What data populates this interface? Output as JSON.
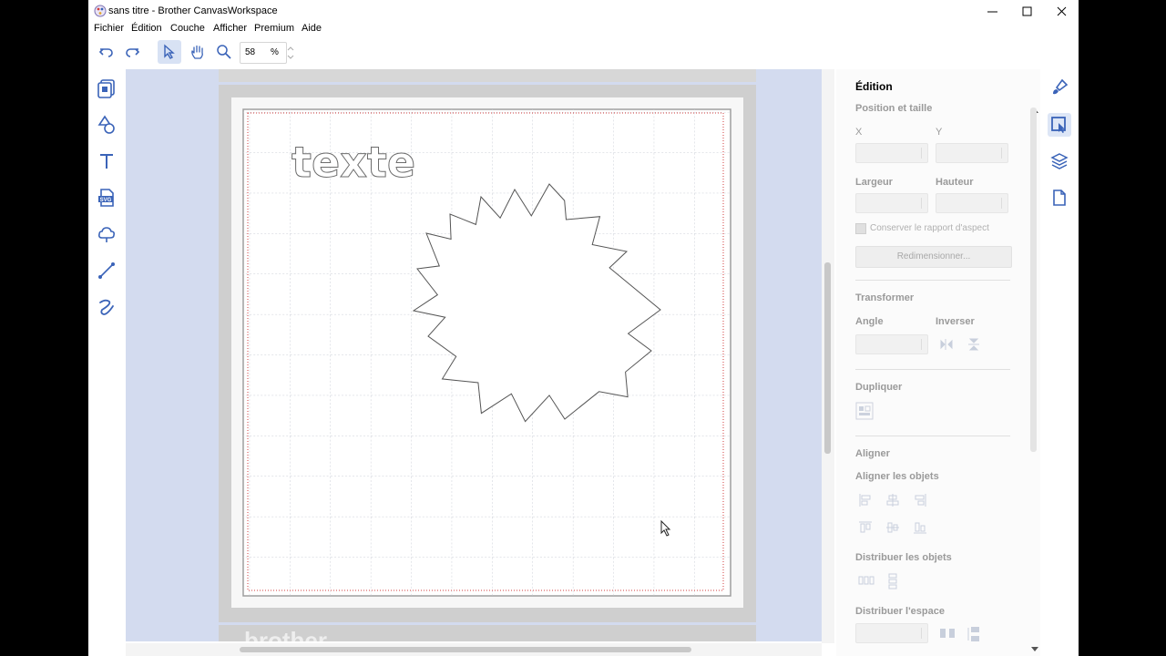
{
  "window": {
    "title": "sans titre - Brother CanvasWorkspace"
  },
  "menu": [
    "Fichier",
    "Édition",
    "Couche",
    "Afficher",
    "Premium",
    "Aide"
  ],
  "toolbar": {
    "zoom_value": "58",
    "zoom_unit": "%"
  },
  "canvas": {
    "sample_text": "texte",
    "brand_text": "brother"
  },
  "panel": {
    "title": "Édition",
    "position_section": "Position et taille",
    "x_label": "X",
    "y_label": "Y",
    "width_label": "Largeur",
    "height_label": "Hauteur",
    "keep_ratio_label": "Conserver le rapport d'aspect",
    "resize_button": "Redimensionner...",
    "transform_section": "Transformer",
    "angle_label": "Angle",
    "invert_label": "Inverser",
    "duplicate_section": "Dupliquer",
    "align_section": "Aligner",
    "align_objects_label": "Aligner les objets",
    "distribute_objects_label": "Distribuer les objets",
    "distribute_space_label": "Distribuer l'espace"
  },
  "colors": {
    "accent": "#3a63b8",
    "canvas_bg": "#d3dbef",
    "cut_line": "#d23c3c"
  }
}
